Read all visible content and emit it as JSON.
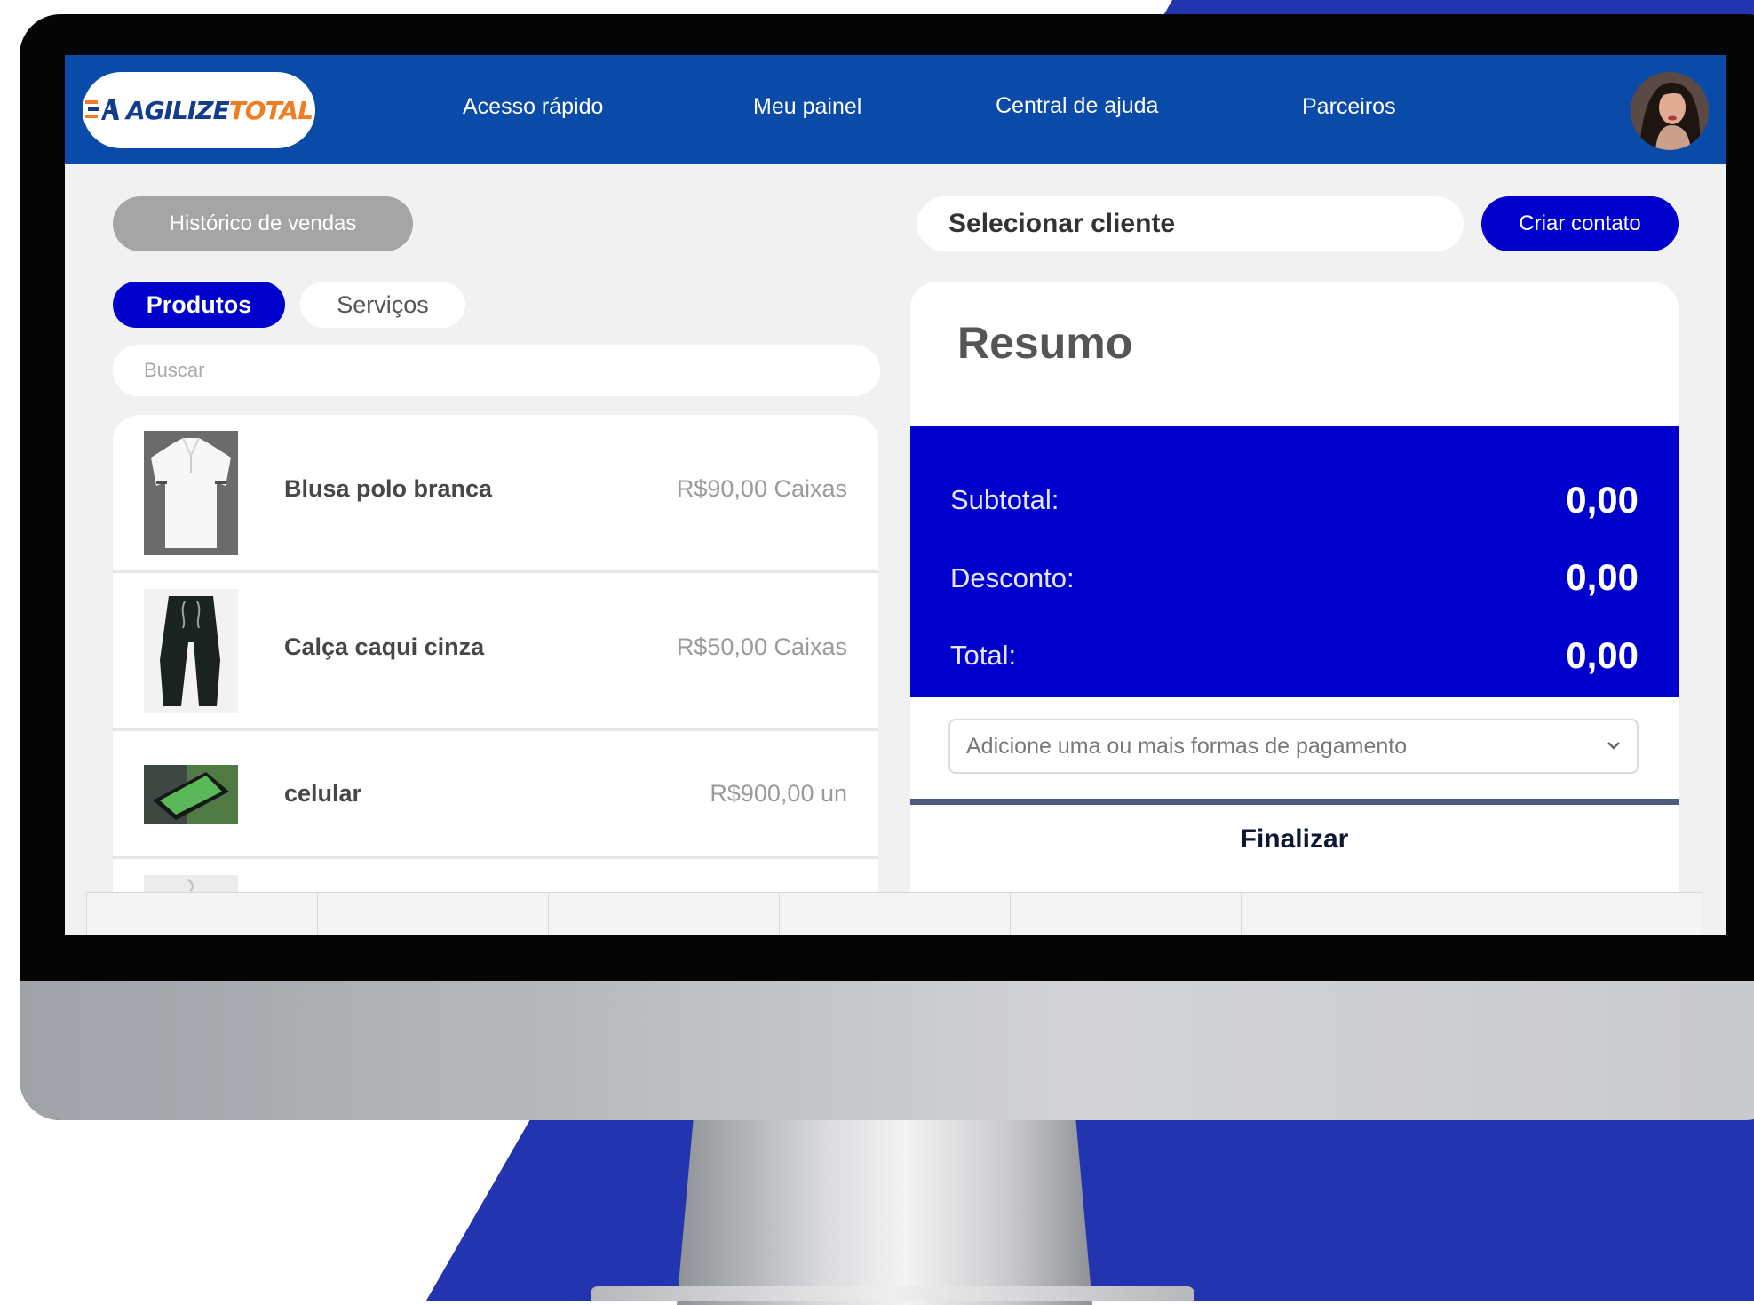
{
  "colors": {
    "background_blue": "#2334b0",
    "header_blue": "#0a4aa8",
    "accent_blue": "#0000cc",
    "logo_orange": "#f07d22",
    "logo_navy": "#123c8c"
  },
  "header": {
    "logo": {
      "part1": "AGILIZE",
      "part2": "TOTAL",
      "icon": "speed-lines-logo-icon"
    },
    "nav": [
      "Acesso rápido",
      "Meu painel",
      "Central de ajuda",
      "Parceiros"
    ],
    "avatar_icon": "user-avatar"
  },
  "left": {
    "history_button": "Histórico de vendas",
    "tabs": {
      "products": "Produtos",
      "services": "Serviços",
      "active": "Produtos"
    },
    "search": {
      "placeholder": "Buscar",
      "value": ""
    },
    "products": [
      {
        "name": "Blusa polo  branca",
        "price": "R$90,00 Caixas",
        "thumb": "white-polo-shirt"
      },
      {
        "name": "Calça caqui cinza",
        "price": "R$50,00 Caixas",
        "thumb": "dark-pants"
      },
      {
        "name": "celular",
        "price": "R$900,00 un",
        "thumb": "smartphone"
      }
    ]
  },
  "right": {
    "client_select": "Selecionar cliente",
    "create_contact": "Criar contato",
    "summary": {
      "title": "Resumo",
      "subtotal_label": "Subtotal:",
      "subtotal_value": "0,00",
      "discount_label": "Desconto:",
      "discount_value": "0,00",
      "total_label": "Total:",
      "total_value": "0,00",
      "payment_select": "Adicione uma ou mais formas de pagamento",
      "finish": "Finalizar"
    }
  }
}
